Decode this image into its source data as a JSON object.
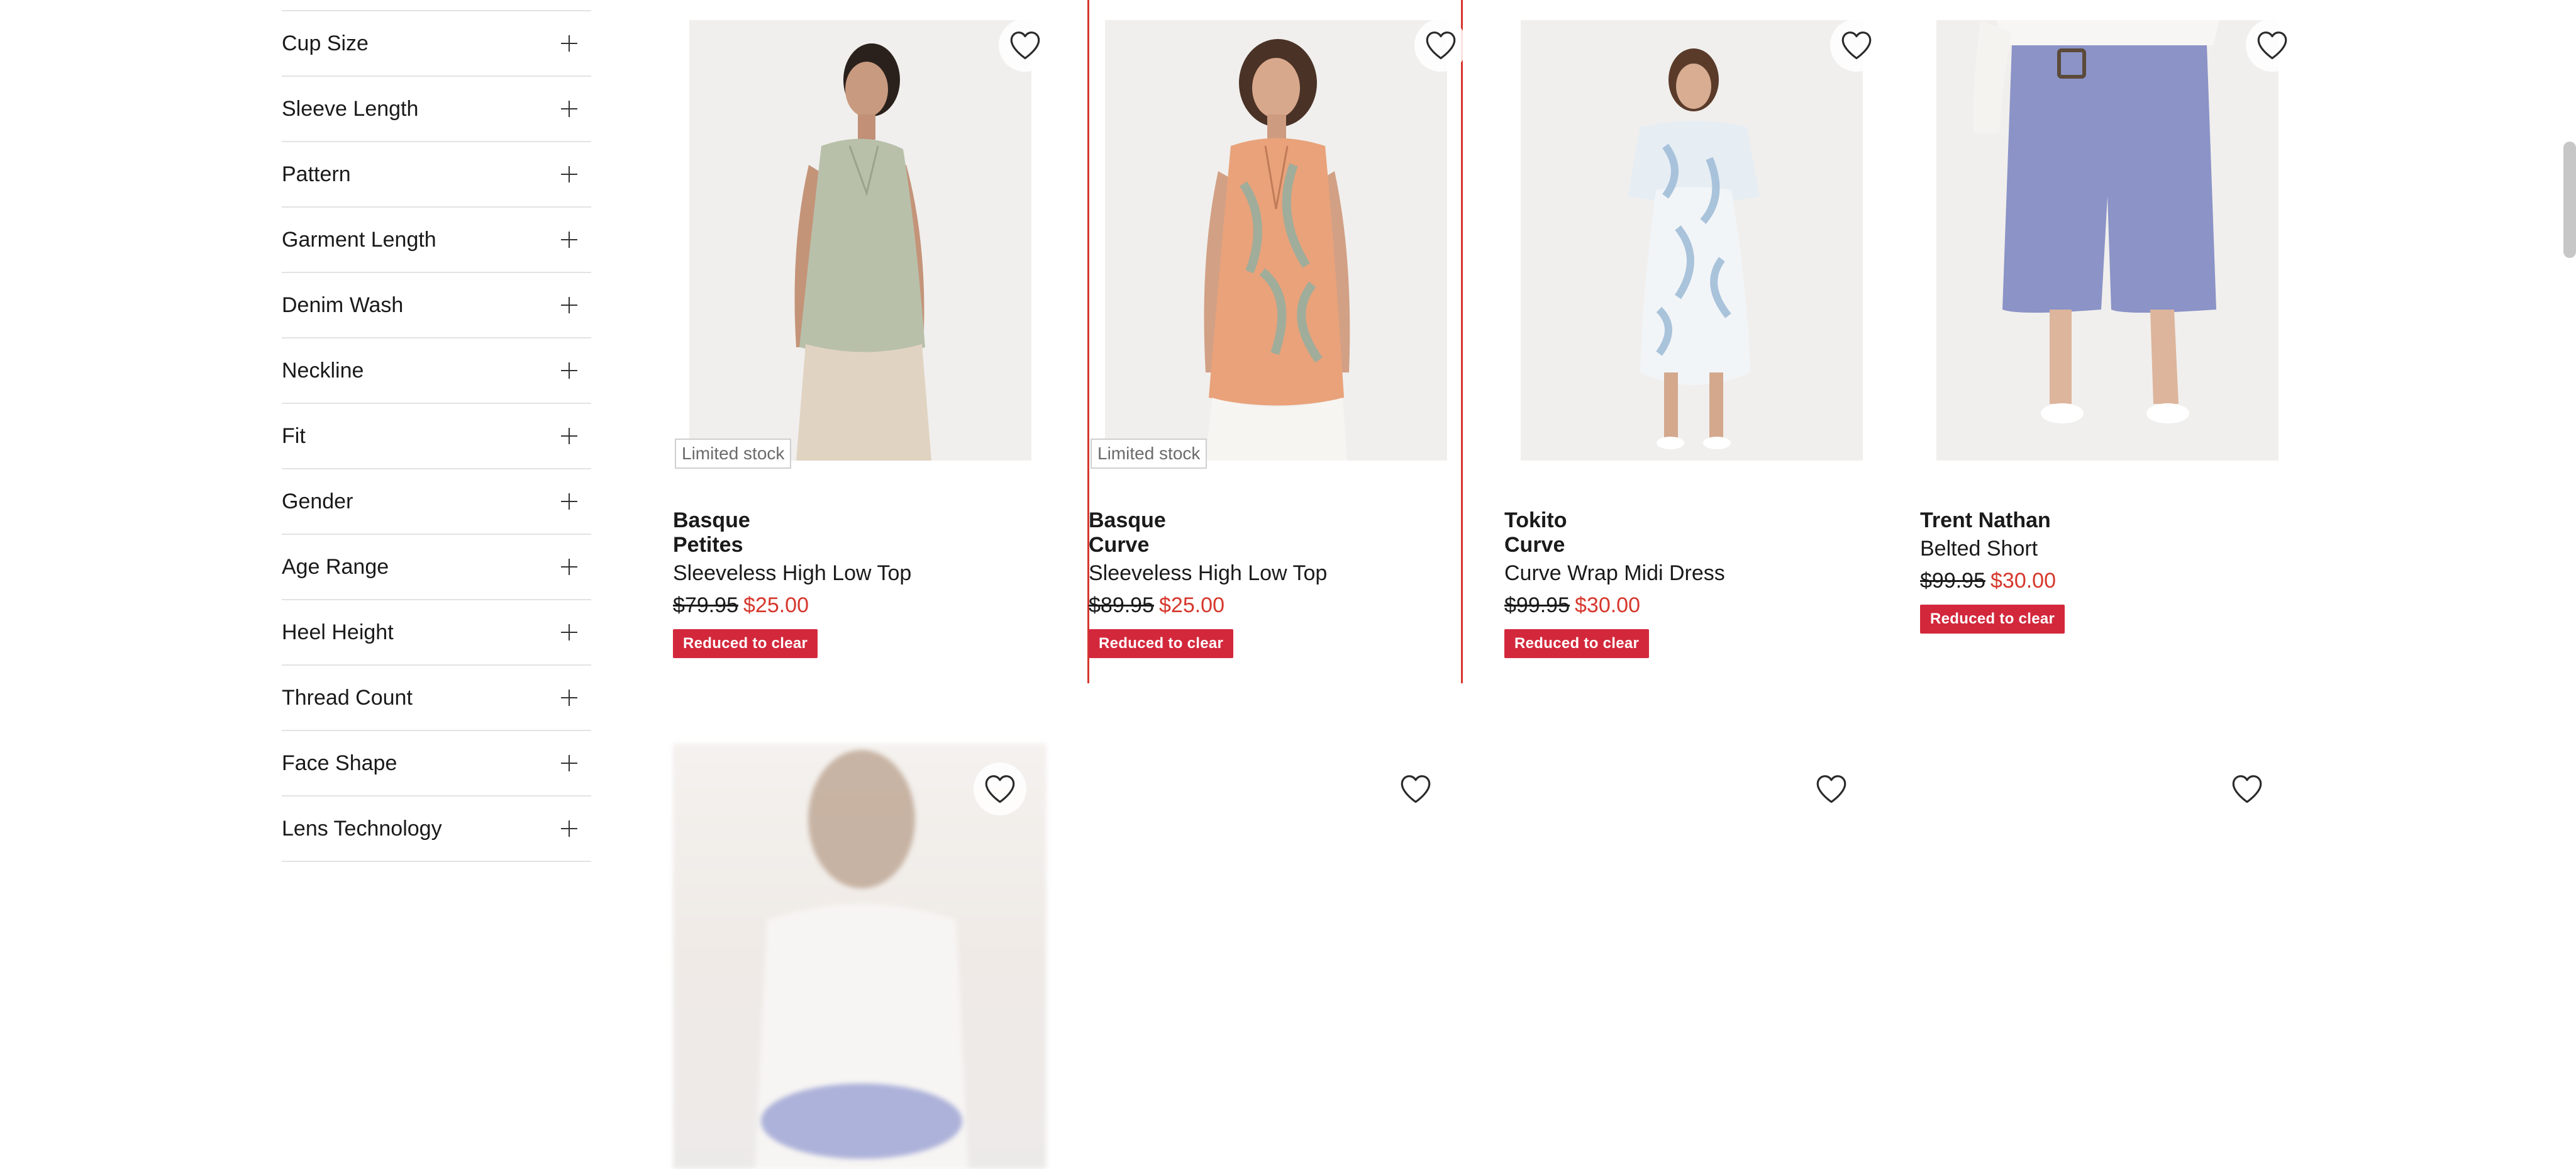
{
  "filters": [
    {
      "label": "Cup Size"
    },
    {
      "label": "Sleeve Length"
    },
    {
      "label": "Pattern"
    },
    {
      "label": "Garment Length"
    },
    {
      "label": "Denim Wash"
    },
    {
      "label": "Neckline"
    },
    {
      "label": "Fit"
    },
    {
      "label": "Gender"
    },
    {
      "label": "Age Range"
    },
    {
      "label": "Heel Height"
    },
    {
      "label": "Thread Count"
    },
    {
      "label": "Face Shape"
    },
    {
      "label": "Lens Technology"
    }
  ],
  "products": [
    {
      "brand": "Basque",
      "sub_brand": "Petites",
      "name": "Sleeveless High Low Top",
      "was_price": "$79.95",
      "now_price": "$25.00",
      "stock_badge": "Limited stock",
      "promo_badge": "Reduced to clear"
    },
    {
      "brand": "Basque",
      "sub_brand": "Curve",
      "name": "Sleeveless High Low Top",
      "was_price": "$89.95",
      "now_price": "$25.00",
      "stock_badge": "Limited stock",
      "promo_badge": "Reduced to clear"
    },
    {
      "brand": "Tokito",
      "sub_brand": "Curve",
      "name": "Curve Wrap Midi Dress",
      "was_price": "$99.95",
      "now_price": "$30.00",
      "promo_badge": "Reduced to clear"
    },
    {
      "brand": "Trent Nathan",
      "name": "Belted Short",
      "was_price": "$99.95",
      "now_price": "$30.00",
      "promo_badge": "Reduced to clear"
    }
  ],
  "icons": {
    "wishlist": "heart-outline-icon",
    "expand": "plus-icon"
  },
  "colors": {
    "sale_price": "#d6372c",
    "promo_badge": "#d3283c",
    "focus_outline": "#d6372c"
  }
}
